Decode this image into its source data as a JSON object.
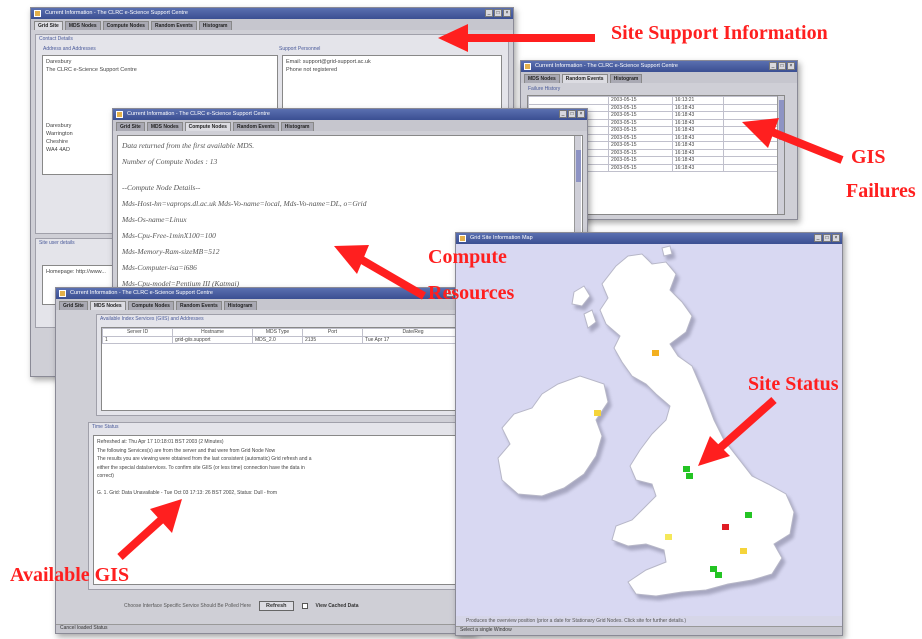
{
  "annotations": {
    "site_support": "Site Support Information",
    "gis_failures_1": "GIS",
    "gis_failures_2": "Failures",
    "compute_1": "Compute",
    "compute_2": "Resources",
    "site_status": "Site Status",
    "available_gis": "Available GIS"
  },
  "win1": {
    "title": "Current Information - The CLRC e-Science Support Centre",
    "tabs": [
      "Grid Site",
      "MDS Nodes",
      "Compute Nodes",
      "Random Events",
      "Histogram"
    ],
    "contact_label": "Contact Details",
    "address_label": "Address and Addresses",
    "support_label": "Support Personnel",
    "address_lines": [
      "Daresbury",
      "The CLRC e-Science Support Centre",
      "",
      "",
      "",
      "",
      "Daresbury",
      "Warrington",
      "Cheshire",
      "WA4 4AD"
    ],
    "support_lines": [
      "Email: support@grid-support.ac.uk",
      "Phone not registered"
    ],
    "lower_label": "Site user details",
    "lower_text": "Homepage: http://www..."
  },
  "win2": {
    "title": "Current Information - The CLRC e-Science Support Centre",
    "tabs": [
      "MDS Nodes",
      "Random Events",
      "Histogram"
    ],
    "panel_label": "Failure History",
    "rows": [
      [
        "2003-05-15",
        "16:13:21"
      ],
      [
        "2003-05-15",
        "16:18:43"
      ],
      [
        "2003-05-15",
        "16:18:43"
      ],
      [
        "2003-05-15",
        "16:18:43"
      ],
      [
        "2003-05-15",
        "16:18:43"
      ],
      [
        "2003-05-15",
        "16:18:43"
      ],
      [
        "2003-05-15",
        "16:18:43"
      ],
      [
        "2003-05-15",
        "16:18:43"
      ],
      [
        "2003-05-15",
        "16:18:43"
      ],
      [
        "2003-05-15",
        "16:18:43"
      ]
    ]
  },
  "win3": {
    "title": "Current Information - The CLRC e-Science Support Centre",
    "tabs": [
      "Grid Site",
      "MDS Nodes",
      "Compute Nodes",
      "Random Events",
      "Histogram"
    ],
    "lines": [
      "Data returned from the first available MDS.",
      "Number of Compute Nodes : 13",
      "",
      "--Compute Node Details--",
      "Mds-Host-hn=vaprops.dl.ac.uk Mds-Vo-name=local, Mds-Vo-name=DL, o=Grid",
      "Mds-Os-name=Linux",
      "Mds-Cpu-Free-1minX100=100",
      "Mds-Memory-Ram-sizeMB=512",
      "Mds-Computer-isa=i686",
      "Mds-Cpu-model=Pentium III (Katmai)"
    ]
  },
  "win4": {
    "title": "Current Information - The CLRC e-Science Support Centre",
    "tabs": [
      "Grid Site",
      "MDS Nodes",
      "Compute Nodes",
      "Random Events",
      "Histogram"
    ],
    "top_label": "Available Index Services (GIIS) and Addresses",
    "columns": [
      "Server ID",
      "Hostname",
      "MDS Type",
      "Port",
      "Date/Reg"
    ],
    "row": [
      "1",
      "grid-giis.support",
      "MDS_2.0",
      "2135",
      "Tue Apr 17"
    ],
    "status_label": "Time Status",
    "status_lines": [
      "Refreshed at: Thu Apr 17 10:18:01 BST 2003 (2 Minutes)",
      "The following Services(s) are from the server and that were from Grid Node Now",
      "The results you are viewing were  obtained from the last consistent (automatic) Grid refresh and a",
      "either the special data/services. To confirm site GIIS (or less time) connection have the data in",
      "correct)",
      "",
      "G. 1.  Grid: Data Unavailable - Tue Oct 03 17:13: 26 BST 2002, Status: Dull - from"
    ],
    "footer_text": "Choose Interface Specific Service Should Be Polled Here",
    "footer_button": "Refresh",
    "footer_check": "View Cached Data",
    "status_bar": "Cancel loaded Status"
  },
  "win5": {
    "title": "Grid Site Information Map",
    "footer": "Produces the overview position (prior a date for Stationary Grid Nodes. Click site for further details.)",
    "status_bar": "Select a single Window"
  },
  "map": {
    "sea_color": "#d8d8f2",
    "land_color": "#ffffff",
    "sites": [
      {
        "name": "Scotland site",
        "status": "yellow"
      },
      {
        "name": "Belfast site",
        "status": "yellow"
      },
      {
        "name": "Manchester site 1",
        "status": "green"
      },
      {
        "name": "Manchester site 2",
        "status": "green"
      },
      {
        "name": "Cambridge site",
        "status": "green"
      },
      {
        "name": "Oxford site",
        "status": "red"
      },
      {
        "name": "Bristol site",
        "status": "yellow"
      },
      {
        "name": "London site",
        "status": "yellow"
      },
      {
        "name": "Southampton site 1",
        "status": "green"
      },
      {
        "name": "Southampton site 2",
        "status": "green"
      }
    ]
  }
}
